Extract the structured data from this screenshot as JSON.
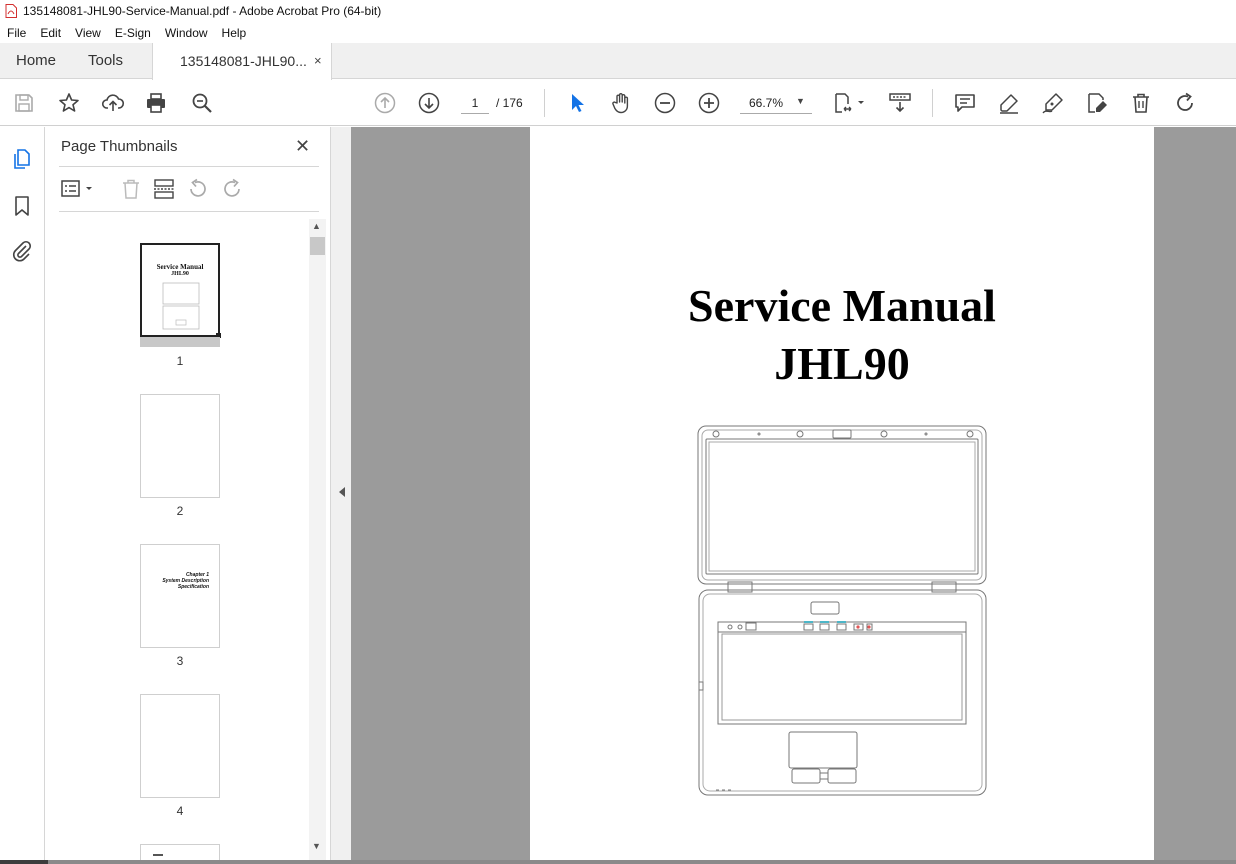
{
  "window": {
    "title": "135148081-JHL90-Service-Manual.pdf - Adobe Acrobat Pro (64-bit)"
  },
  "menu": {
    "items": [
      "File",
      "Edit",
      "View",
      "E-Sign",
      "Window",
      "Help"
    ]
  },
  "tabs": {
    "home": "Home",
    "tools": "Tools",
    "document": "135148081-JHL90...",
    "close": "×"
  },
  "toolbar": {
    "page_current": "1",
    "page_total": "/ 176",
    "zoom": "66.7%",
    "icons": [
      "save-icon",
      "star-icon",
      "upload-icon",
      "print-icon",
      "search-zoom-icon",
      "page-up-icon",
      "page-down-icon",
      "select-cursor-icon",
      "hand-icon",
      "zoom-out-icon",
      "zoom-in-icon",
      "fit-page-icon",
      "scroll-mode-icon",
      "comment-icon",
      "highlight-icon",
      "sign-icon",
      "fill-sign-icon",
      "delete-icon",
      "rotate-icon"
    ]
  },
  "thumbnails_panel": {
    "title": "Page Thumbnails",
    "close": "✕",
    "thumbs": [
      {
        "num": "1",
        "line1": "Service Manual",
        "line2": "JHL90"
      },
      {
        "num": "2"
      },
      {
        "num": "3",
        "line1": "Chapter 1",
        "line2": "System Description",
        "line3": "Specification"
      },
      {
        "num": "4"
      }
    ]
  },
  "document": {
    "title_line1": "Service Manual",
    "title_line2": "JHL90"
  },
  "colors": {
    "accent": "#1473e6",
    "doc_background": "#9b9b9b",
    "pdf_red": "#d32f2f"
  }
}
